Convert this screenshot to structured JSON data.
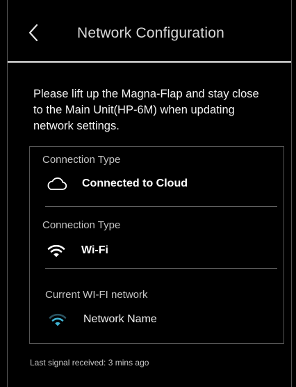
{
  "header": {
    "title": "Network Configuration",
    "back_icon": "chevron-left-icon"
  },
  "instructions": "Please lift up the Magna-Flap and stay close to the Main Unit(HP-6M) when updating network settings.",
  "card": {
    "cloud": {
      "label": "Connection Type",
      "value": "Connected to Cloud",
      "icon": "cloud-icon"
    },
    "connection": {
      "label": "Connection Type",
      "value": "Wi-Fi",
      "icon": "wifi-icon"
    },
    "network": {
      "label": "Current WI-FI network",
      "value": "Network Name",
      "icon": "wifi-signal-icon",
      "signal_color": "#3fb4d4"
    }
  },
  "footer": {
    "last_signal": "Last signal received: 3 mins ago"
  }
}
